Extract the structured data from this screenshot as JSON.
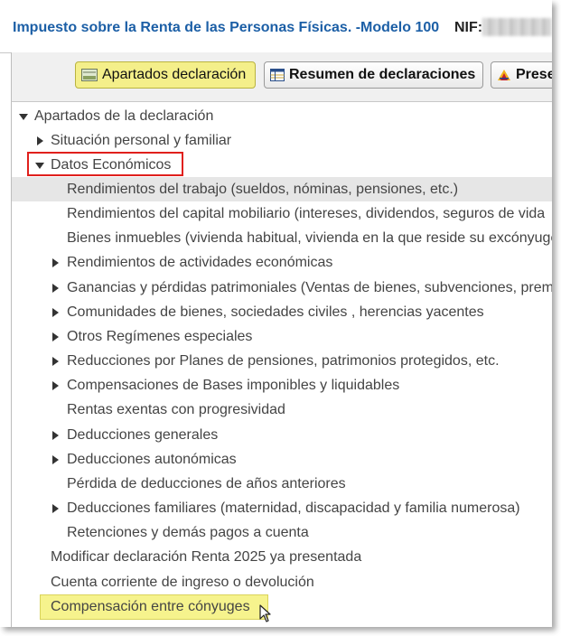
{
  "header": {
    "title": "Impuesto sobre la Renta de las Personas Físicas. -Modelo 100",
    "nif_label": "NIF:"
  },
  "toolbar": {
    "apartados_label": "Apartados declaración",
    "resumen_label": "Resumen de declaraciones",
    "presentar_label": "Prese"
  },
  "tree": {
    "root": "Apartados de la declaración",
    "situacion": "Situación personal y familiar",
    "datos": "Datos Económicos",
    "items": [
      "Rendimientos del trabajo (sueldos, nóminas, pensiones, etc.)",
      "Rendimientos del capital mobiliario (intereses, dividendos, seguros de vida",
      "Bienes inmuebles (vivienda habitual, vivienda en la que reside su excónyuge",
      "Rendimientos de actividades económicas",
      "Ganancias y pérdidas patrimoniales (Ventas de bienes, subvenciones, prem",
      "Comunidades de bienes, sociedades civiles , herencias yacentes",
      "Otros Regímenes especiales",
      "Reducciones por Planes de pensiones, patrimonios protegidos, etc.",
      "Compensaciones de Bases imponibles y liquidables",
      "Rentas exentas con progresividad",
      "Deducciones generales",
      "Deducciones autonómicas",
      "Pérdida de deducciones de años anteriores",
      "Deducciones familiares (maternidad, discapacidad y familia numerosa)",
      "Retenciones y demás pagos a cuenta"
    ],
    "modificar": "Modificar declaración Renta 2025 ya presentada",
    "cuenta": "Cuenta corriente de ingreso o devolución",
    "compensacion": "Compensación entre cónyuges"
  },
  "icons": {
    "apartados": "form-icon",
    "resumen": "table-icon",
    "presentar": "aeat-logo-icon",
    "expanded": "triangle-down-icon",
    "collapsed": "triangle-right-icon",
    "cursor": "mouse-pointer-icon"
  },
  "colors": {
    "title_blue": "#1c5fa6",
    "highlight_yellow": "#f6f38d",
    "red_box": "#e0201c",
    "selected_row": "#e6e6e6"
  }
}
